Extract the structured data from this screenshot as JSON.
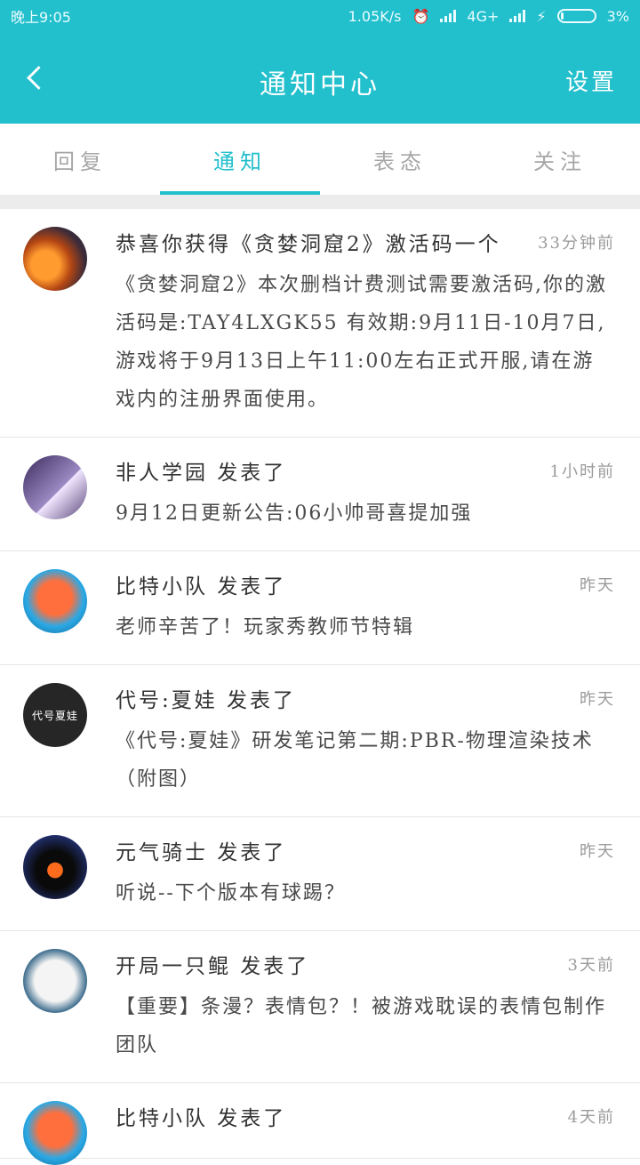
{
  "status_bar": {
    "time": "晚上9:05",
    "speed": "1.05K/s",
    "network": "4G+",
    "battery": "3%",
    "icons": [
      "alarm-icon",
      "signal-icon",
      "signal-icon",
      "lightning-icon",
      "battery-icon"
    ]
  },
  "header": {
    "title": "通知中心",
    "back_icon": "chevron-left-icon",
    "settings_label": "设置",
    "color": "#22bfcc"
  },
  "tabs": [
    {
      "label": "回复"
    },
    {
      "label": "通知",
      "active": true
    },
    {
      "label": "表态"
    },
    {
      "label": "关注"
    }
  ],
  "notifications": [
    {
      "title": "恭喜你获得《贪婪洞窟2》激活码一个",
      "time": "33分钟前",
      "body": "《贪婪洞窟2》本次删档计费测试需要激活码,你的激活码是:TAY4LXGK55 有效期:9月11日-10月7日,游戏将于9月13日上午11:00左右正式开服,请在游戏内的注册界面使用。"
    },
    {
      "title": "非人学园 发表了",
      "time": "1小时前",
      "body": "9月12日更新公告:06小帅哥喜提加强"
    },
    {
      "title": "比特小队 发表了",
      "time": "昨天",
      "body": "老师辛苦了！玩家秀教师节特辑"
    },
    {
      "title": "代号:夏娃 发表了",
      "time": "昨天",
      "body": "《代号:夏娃》研发笔记第二期:PBR-物理渲染技术（附图）",
      "avatar_text": "代号夏娃"
    },
    {
      "title": "元气骑士 发表了",
      "time": "昨天",
      "body": "听说--下个版本有球踢？"
    },
    {
      "title": "开局一只鲲 发表了",
      "time": "3天前",
      "body": "【重要】条漫？表情包？！被游戏耽误的表情包制作团队"
    },
    {
      "title": "比特小队 发表了",
      "time": "4天前",
      "body": ""
    }
  ]
}
